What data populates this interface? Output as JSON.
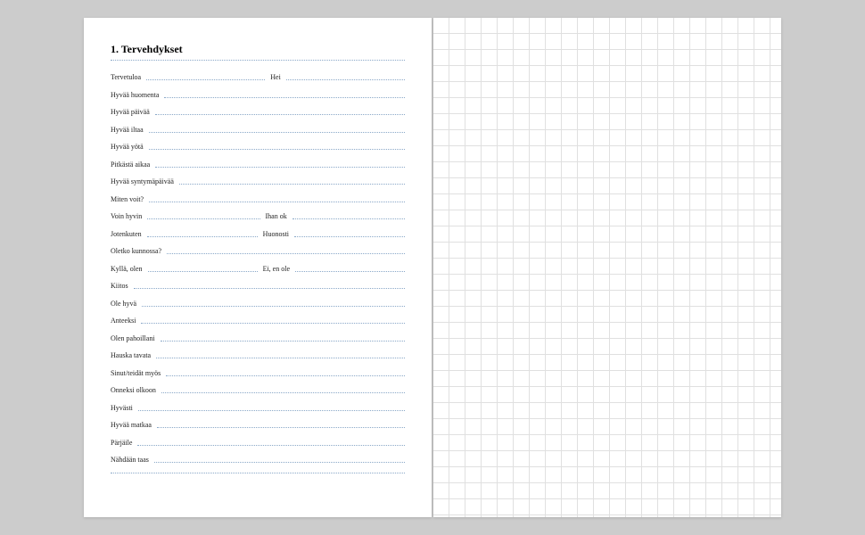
{
  "heading": "1. Tervehdykset",
  "rows": [
    {
      "cells": [
        "Tervetuloa",
        "Hei"
      ]
    },
    {
      "cells": [
        "Hyvää huomenta"
      ]
    },
    {
      "cells": [
        "Hyvää päivää"
      ]
    },
    {
      "cells": [
        "Hyvää iltaa"
      ]
    },
    {
      "cells": [
        "Hyvää yötä"
      ]
    },
    {
      "cells": [
        "Pitkästä aikaa"
      ]
    },
    {
      "cells": [
        "Hyvää syntymäpäivää"
      ]
    },
    {
      "cells": [
        "Miten voit?"
      ]
    },
    {
      "cells": [
        "Voin hyvin",
        "Ihan ok"
      ]
    },
    {
      "cells": [
        "Jotenkuten",
        "Huonosti"
      ]
    },
    {
      "cells": [
        "Oletko kunnossa?"
      ]
    },
    {
      "cells": [
        "Kyllä, olen",
        "Ei, en ole"
      ]
    },
    {
      "cells": [
        "Kiitos"
      ]
    },
    {
      "cells": [
        "Ole hyvä"
      ]
    },
    {
      "cells": [
        "Anteeksi"
      ]
    },
    {
      "cells": [
        "Olen pahoillani"
      ]
    },
    {
      "cells": [
        "Hauska tavata"
      ]
    },
    {
      "cells": [
        "Sinut/teidät myös"
      ]
    },
    {
      "cells": [
        "Onneksi olkoon"
      ]
    },
    {
      "cells": [
        "Hyvästi"
      ]
    },
    {
      "cells": [
        "Hyvää matkaa"
      ]
    },
    {
      "cells": [
        "Pärjäile"
      ]
    },
    {
      "cells": [
        "Nähdään taas"
      ]
    },
    {
      "cells": [
        ""
      ]
    }
  ]
}
